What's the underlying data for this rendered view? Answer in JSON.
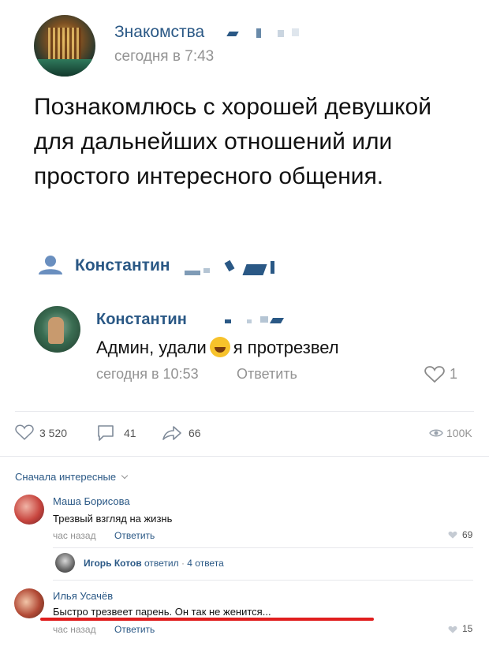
{
  "post": {
    "author": "Знакомства",
    "time": "сегодня в 7:43",
    "text": "Познакомлюсь с хорошей девушкой для дальнейших отношений или простого интересного общения.",
    "attribution_name": "Константин"
  },
  "quoted_comment": {
    "name": "Константин",
    "text_before": "Админ, удали",
    "text_after": "я протрезвел",
    "time": "сегодня в 10:53",
    "reply_label": "Ответить",
    "likes": "1"
  },
  "actions": {
    "likes": "3 520",
    "comments": "41",
    "shares": "66",
    "views": "100K"
  },
  "comments_section": {
    "sort_label": "Сначала интересные",
    "comments": [
      {
        "name": "Маша Борисова",
        "text": "Трезвый взгляд на жизнь",
        "time": "час назад",
        "reply_label": "Ответить",
        "likes": "69",
        "thread": {
          "name": "Игорь Котов",
          "replied_label": "ответил",
          "count_label": "4 ответа"
        }
      },
      {
        "name": "Илья Усачёв",
        "text": "Быстро трезвеет парень. Он так не женится...",
        "time": "час назад",
        "reply_label": "Ответить",
        "likes": "15"
      }
    ]
  },
  "colors": {
    "link": "#2a5885",
    "muted": "#939393",
    "underline": "#e01e1e"
  }
}
